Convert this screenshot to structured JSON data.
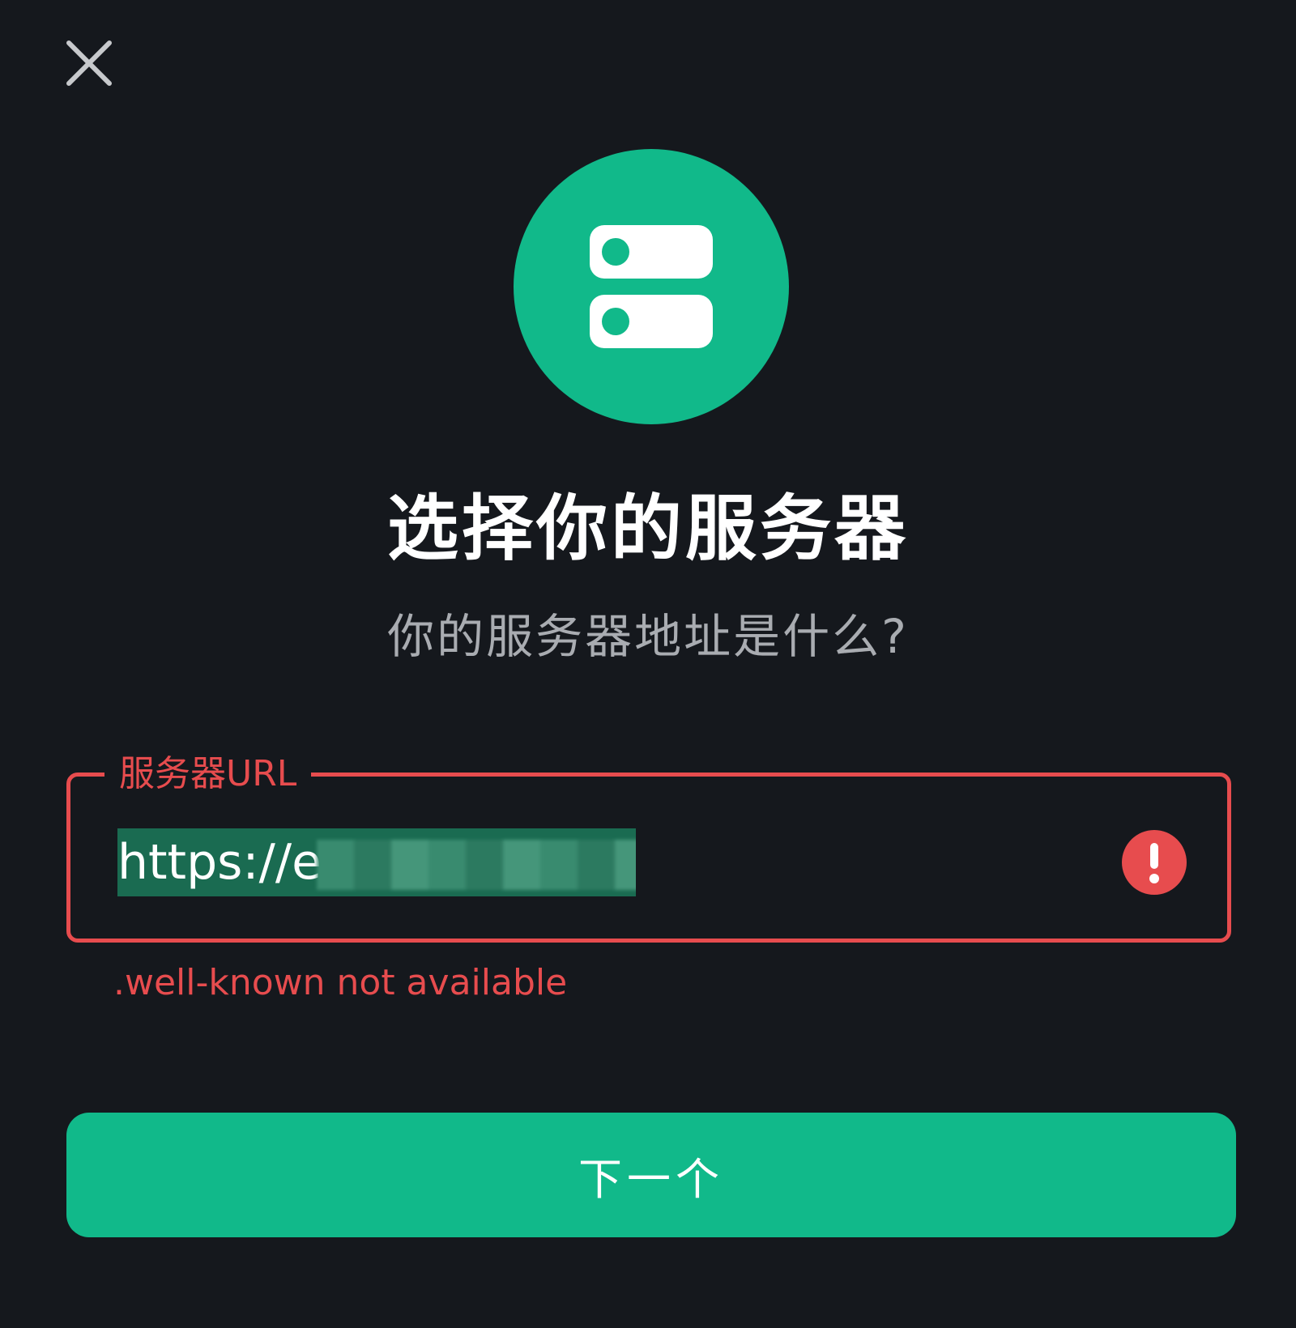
{
  "header": {
    "close_icon": "close-icon"
  },
  "hero": {
    "icon": "server-icon",
    "accent_color": "#11b98a"
  },
  "title": "选择你的服务器",
  "subtitle": "你的服务器地址是什么?",
  "server_field": {
    "label": "服务器URL",
    "visible_value": "https://e",
    "error_icon": "error-icon",
    "error_color": "#e74c4e",
    "error_message": ".well-known not available"
  },
  "actions": {
    "next_label": "下一个"
  }
}
